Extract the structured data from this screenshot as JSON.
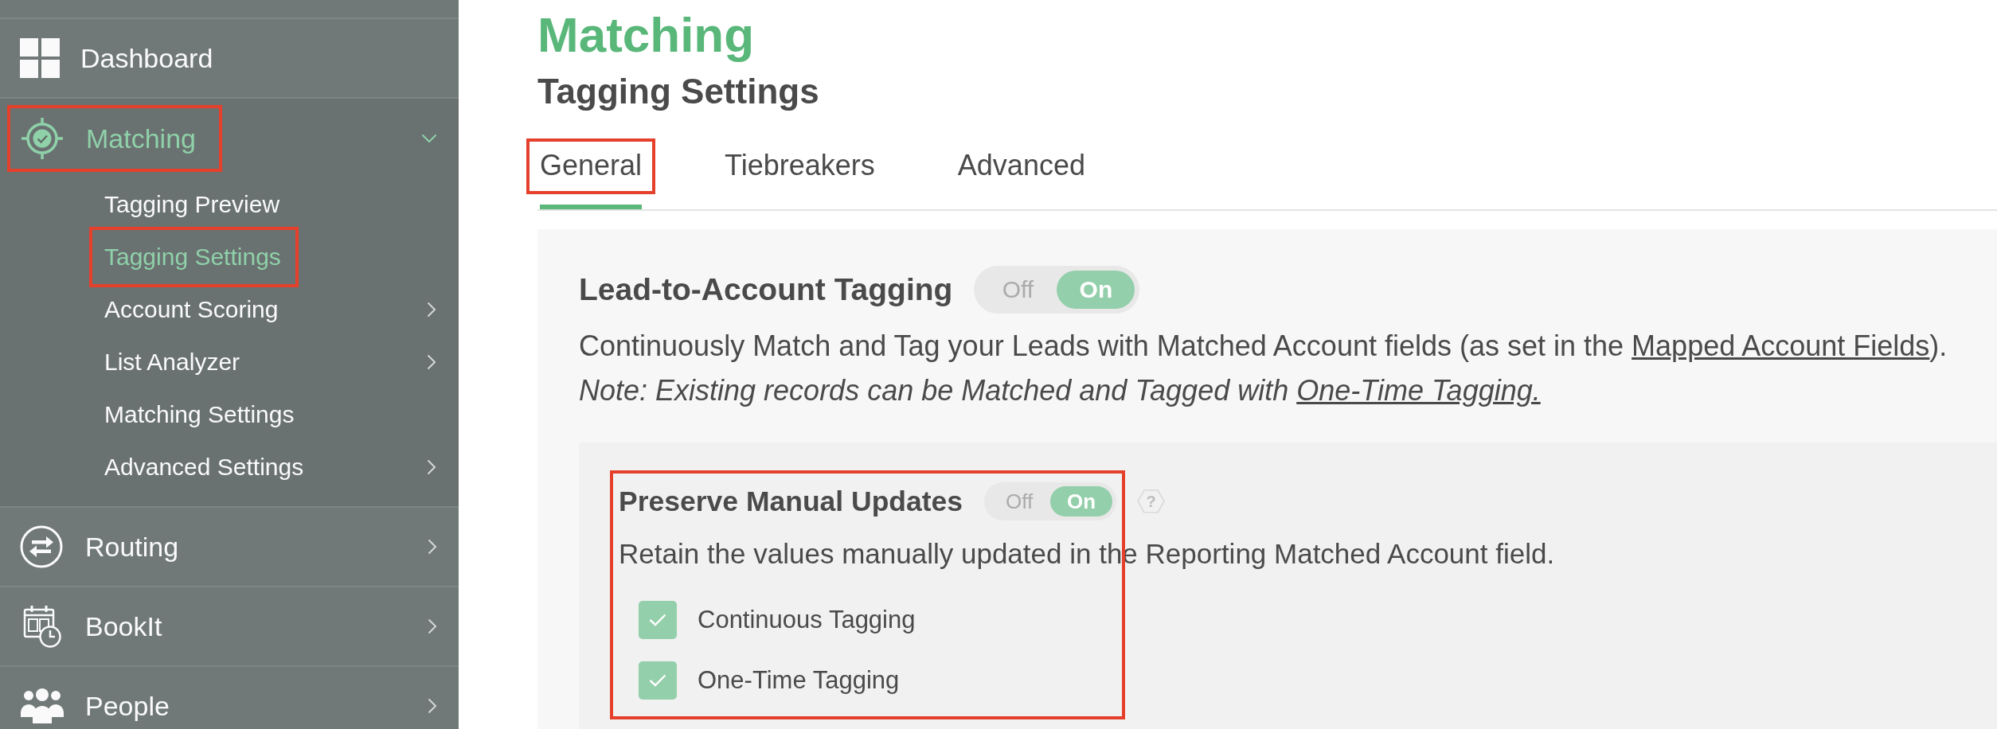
{
  "sidebar": {
    "items": [
      {
        "label": "Dashboard",
        "selected": false,
        "highlighted": false
      },
      {
        "label": "Matching",
        "selected": true,
        "highlighted": true,
        "expanded": true,
        "children": [
          {
            "label": "Tagging Preview",
            "selected": false,
            "highlighted": false
          },
          {
            "label": "Tagging Settings",
            "selected": true,
            "highlighted": true
          },
          {
            "label": "Account Scoring",
            "selected": false,
            "highlighted": false,
            "expanded": false
          },
          {
            "label": "List Analyzer",
            "selected": false,
            "highlighted": false,
            "expanded": false
          },
          {
            "label": "Matching Settings",
            "selected": false,
            "highlighted": false
          },
          {
            "label": "Advanced Settings",
            "selected": false,
            "highlighted": false,
            "expanded": false
          }
        ]
      },
      {
        "label": "Routing",
        "selected": false,
        "highlighted": false,
        "expanded": false
      },
      {
        "label": "BookIt",
        "selected": false,
        "highlighted": false,
        "expanded": false
      },
      {
        "label": "People",
        "selected": false,
        "highlighted": false,
        "expanded": false
      }
    ]
  },
  "page_title": "Matching",
  "page_subtitle": "Tagging Settings",
  "tabs": [
    {
      "label": "General",
      "selected": true,
      "highlighted": true
    },
    {
      "label": "Tiebreakers",
      "selected": false,
      "highlighted": false
    },
    {
      "label": "Advanced",
      "selected": false,
      "highlighted": false
    }
  ],
  "lead_to_account_tagging": {
    "title": "Lead-to-Account Tagging",
    "toggle": {
      "off_label": "Off",
      "on_label": "On",
      "on": true
    },
    "description": [
      {
        "kind": "text",
        "text": "Continuously Match and Tag your Leads with Matched Account fields (as set in the "
      },
      {
        "kind": "link",
        "text": "Mapped Account Fields"
      },
      {
        "kind": "text",
        "text": ")."
      }
    ],
    "note": [
      {
        "kind": "text",
        "text": "Note: Existing records can be Matched and Tagged with "
      },
      {
        "kind": "link",
        "text": "One-Time Tagging."
      }
    ],
    "preserve_manual_updates": {
      "title": "Preserve Manual Updates",
      "highlighted": true,
      "toggle": {
        "off_label": "Off",
        "on_label": "On",
        "on": true
      },
      "help": "?",
      "description": "Retain the values manually updated in the Reporting Matched Account field.",
      "options": [
        {
          "label": "Continuous Tagging",
          "checked": true
        },
        {
          "label": "One-Time Tagging",
          "checked": true
        }
      ]
    }
  }
}
